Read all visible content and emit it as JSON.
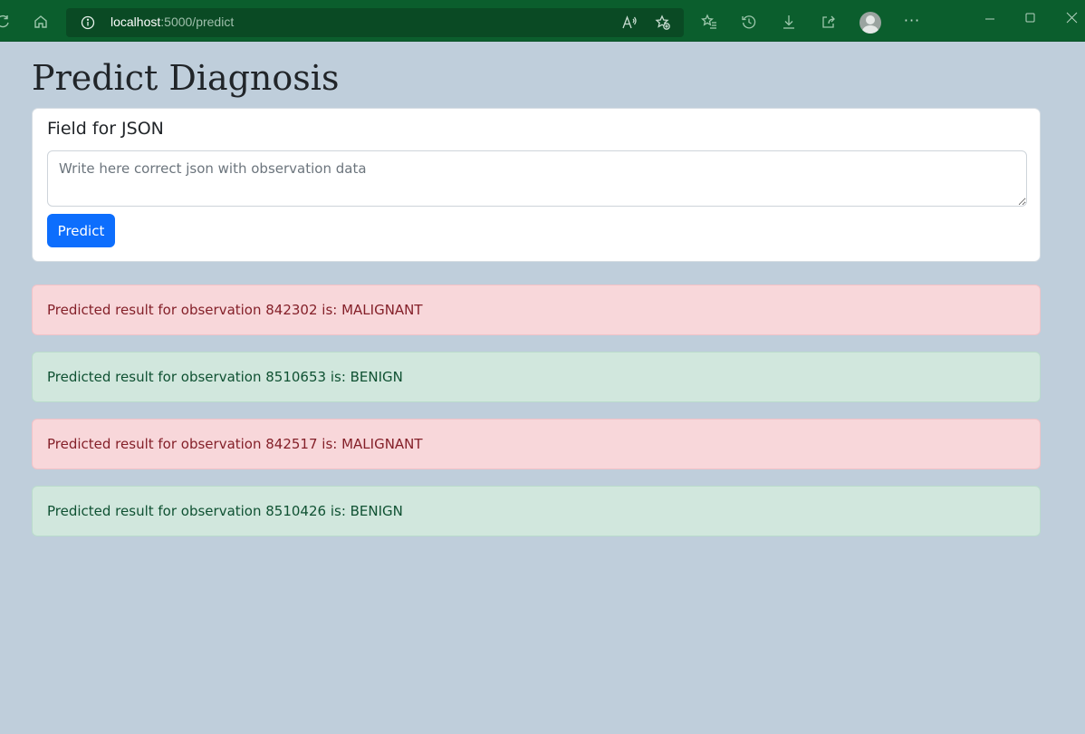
{
  "browser": {
    "url_host": "localhost",
    "url_path": ":5000/predict",
    "read_aloud_icon": "read-aloud-icon",
    "colors": {
      "chrome": "#0b5e2d",
      "address_bar": "#0a4a24"
    }
  },
  "page": {
    "title": "Predict Diagnosis",
    "background": "#bfcedb"
  },
  "form": {
    "label": "Field for JSON",
    "placeholder": "Write here correct json with observation data",
    "value": "",
    "button_label": "Predict",
    "button_color": "#0d6efd"
  },
  "results": [
    {
      "text": "Predicted result for observation 842302 is: MALIGNANT",
      "status": "danger"
    },
    {
      "text": "Predicted result for observation 8510653 is: BENIGN",
      "status": "success"
    },
    {
      "text": "Predicted result for observation 842517 is: MALIGNANT",
      "status": "danger"
    },
    {
      "text": "Predicted result for observation 8510426 is: BENIGN",
      "status": "success"
    }
  ]
}
